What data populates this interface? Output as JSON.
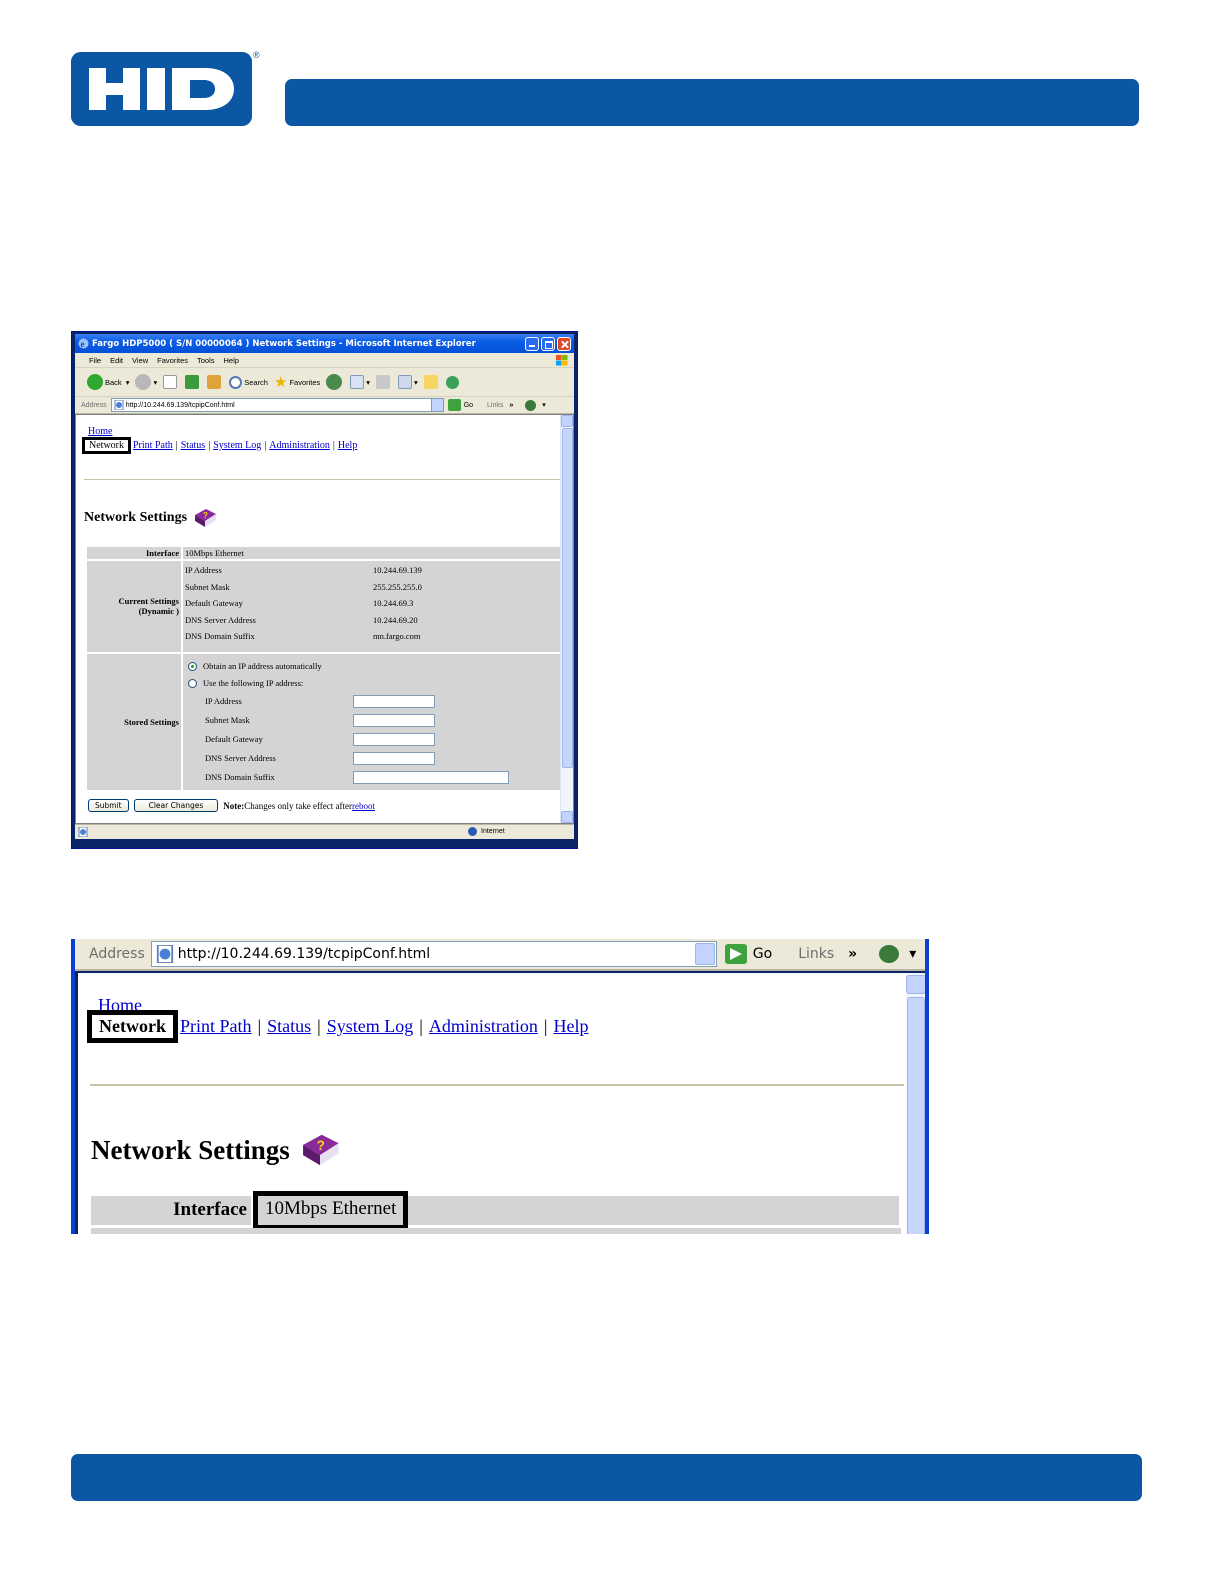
{
  "brand": {
    "logo_text": "HID",
    "registered": "®",
    "color": "#0b57a4"
  },
  "browser": {
    "title": "Fargo HDP5000 ( S/N 00000064 ) Network Settings - Microsoft Internet Explorer",
    "menu": [
      "File",
      "Edit",
      "View",
      "Favorites",
      "Tools",
      "Help"
    ],
    "toolbar": {
      "back": "Back",
      "search": "Search",
      "favorites": "Favorites"
    },
    "address_label": "Address",
    "address_url": "http://10.244.69.139/tcpipConf.html",
    "go": "Go",
    "links": "Links",
    "links_chevron": "»",
    "status_zone": "Internet"
  },
  "page": {
    "home_link": "Home",
    "nav": {
      "active": "Network",
      "items": [
        "Print Path",
        "Status",
        "System Log",
        "Administration",
        "Help"
      ],
      "separator": "|"
    },
    "heading": "Network Settings",
    "interface": {
      "label": "Interface",
      "value": "10Mbps Ethernet"
    },
    "current": {
      "label_line1": "Current Settings",
      "label_line2": "(Dynamic )",
      "rows": [
        {
          "k": "IP Address",
          "v": "10.244.69.139"
        },
        {
          "k": "Subnet Mask",
          "v": "255.255.255.0"
        },
        {
          "k": "Default Gateway",
          "v": "10.244.69.3"
        },
        {
          "k": "DNS Server Address",
          "v": "10.244.69.20"
        },
        {
          "k": "DNS Domain Suffix",
          "v": "mn.fargo.com"
        }
      ]
    },
    "stored": {
      "label": "Stored Settings",
      "radio_auto": "Obtain an IP address automatically",
      "radio_manual": "Use the following IP address:",
      "fields": [
        "IP Address",
        "Subnet Mask",
        "Default Gateway",
        "DNS Server Address",
        "DNS Domain Suffix"
      ]
    },
    "buttons": {
      "submit": "Submit",
      "clear": "Clear Changes"
    },
    "note_label": "Note:",
    "note_text": " Changes only take effect after ",
    "reboot_link": "reboot"
  }
}
